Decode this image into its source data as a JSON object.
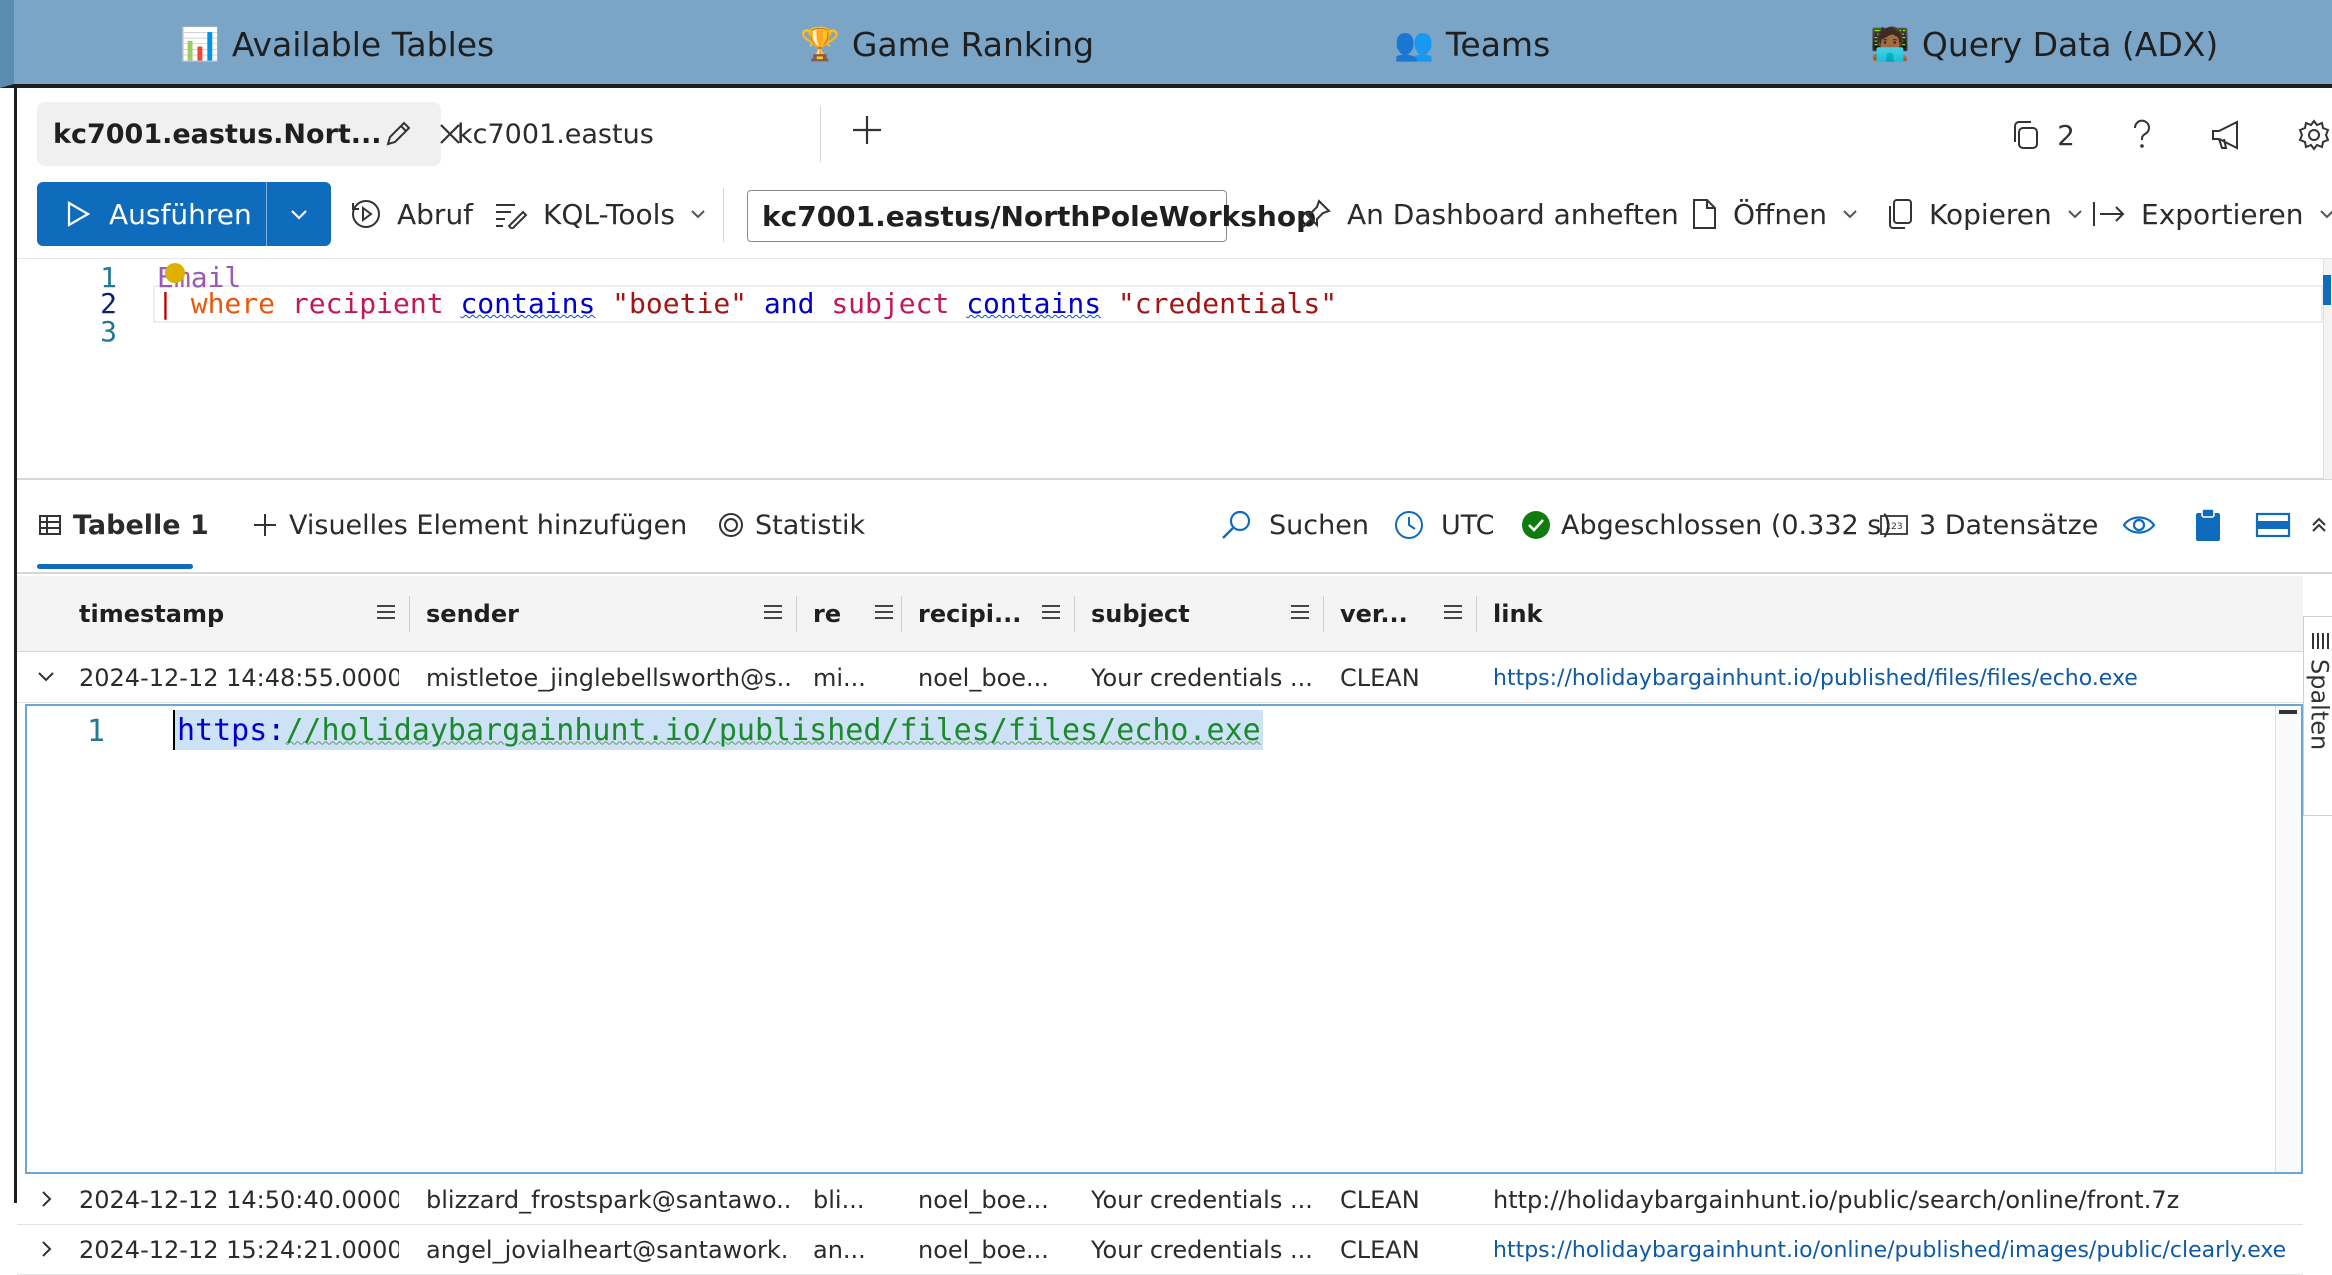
{
  "topnav": {
    "items": [
      {
        "emoji": "📊",
        "label": "Available Tables"
      },
      {
        "emoji": "🏆",
        "label": "Game Ranking"
      },
      {
        "emoji": "👥",
        "label": "Teams"
      },
      {
        "emoji": "🧑🏾‍💻",
        "label": "Query Data (ADX)"
      }
    ]
  },
  "tabs": {
    "active": "kc7001.eastus.Nort...",
    "second": "kc7001.eastus",
    "open_count": "2"
  },
  "toolbar": {
    "run": "Ausführen",
    "recall": "Abruf",
    "kql_tools": "KQL-Tools",
    "database": "kc7001.eastus/NorthPoleWorkshop",
    "pin": "An Dashboard anheften",
    "open": "Öffnen",
    "copy": "Kopieren",
    "export": "Exportieren"
  },
  "editor": {
    "line_numbers": [
      "1",
      "2",
      "3"
    ],
    "table": "Email",
    "pipe": "|",
    "where": "where",
    "col1": "recipient",
    "op1": "contains",
    "str1": "\"boetie\"",
    "and": "and",
    "col2": "subject",
    "op2": "contains",
    "str2": "\"credentials\""
  },
  "results": {
    "tab": "Tabelle 1",
    "add_visual": "Visuelles Element hinzufügen",
    "stats": "Statistik",
    "search": "Suchen",
    "tz": "UTC",
    "status": "Abgeschlossen (0.332 s)",
    "records": "3 Datensätze"
  },
  "grid": {
    "columns": [
      "timestamp",
      "sender",
      "re",
      "recipi...",
      "subject",
      "ver...",
      "link"
    ],
    "rows": [
      {
        "timestamp": "2024-12-12 14:48:55.0000",
        "sender": "mistletoe_jinglebellsworth@s...",
        "reply_to": "mi...",
        "recipient": "noel_boe...",
        "subject": "Your credentials ...",
        "verdict": "CLEAN",
        "link": "https://holidaybargainhunt.io/published/files/files/echo.exe",
        "link_style": "link"
      },
      {
        "timestamp": "2024-12-12 14:50:40.0000",
        "sender": "blizzard_frostspark@santawo...",
        "reply_to": "bli...",
        "recipient": "noel_boe...",
        "subject": "Your credentials ...",
        "verdict": "CLEAN",
        "link": "http://holidaybargainhunt.io/public/search/online/front.7z",
        "link_style": "plain"
      },
      {
        "timestamp": "2024-12-12 15:24:21.0000",
        "sender": "angel_jovialheart@santawork...",
        "reply_to": "an...",
        "recipient": "noel_boe...",
        "subject": "Your credentials ...",
        "verdict": "CLEAN",
        "link": "https://holidaybargainhunt.io/online/published/images/public/clearly.exe",
        "link_style": "link"
      }
    ],
    "detail": {
      "line": "1",
      "proto": "https:",
      "rest": "//holidaybargainhunt.io/published/files/files/echo.exe"
    }
  },
  "side_panel": {
    "columns": "Spalten"
  },
  "colors": {
    "nav_bg": "#7aa5c6",
    "accent": "#0f6cbd",
    "success": "#107c10"
  }
}
